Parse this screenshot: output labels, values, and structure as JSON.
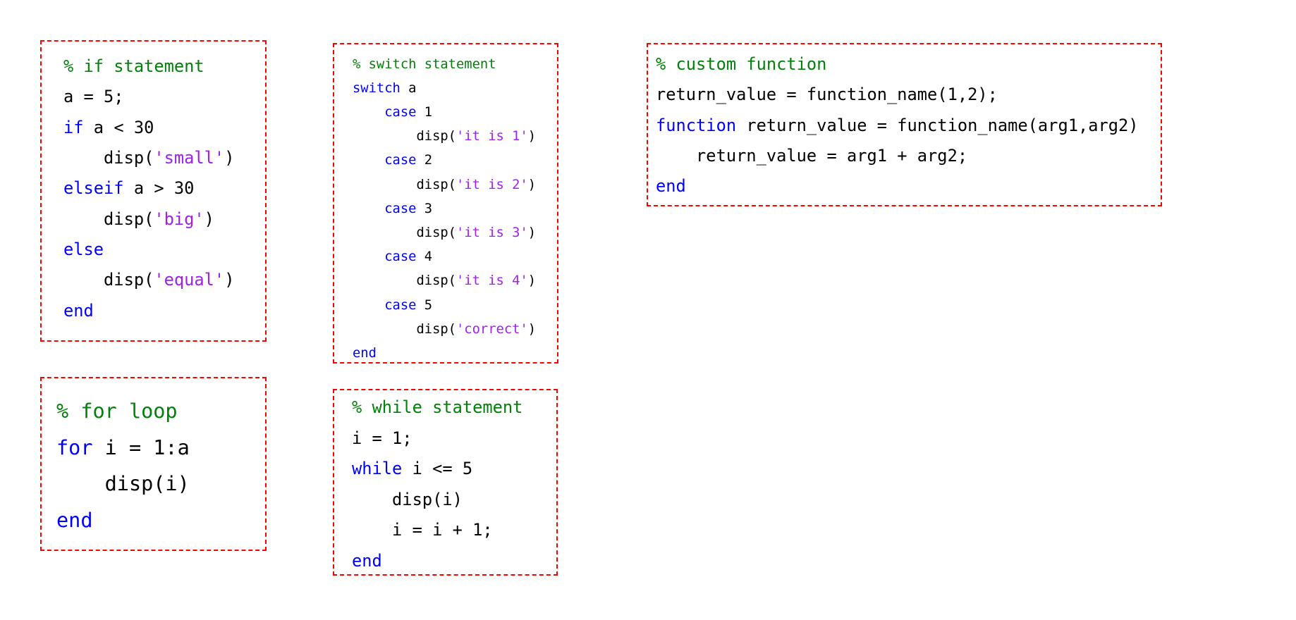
{
  "colors": {
    "comment": "#028009",
    "keyword": "#0000ff",
    "string": "#a020f0",
    "plain": "#000000",
    "border": "#ff0000"
  },
  "blocks": {
    "if_statement": {
      "lines": [
        [
          {
            "t": "comment",
            "v": "% if statement"
          }
        ],
        [
          {
            "t": "plain",
            "v": "a = 5;"
          }
        ],
        [
          {
            "t": "keyword",
            "v": "if"
          },
          {
            "t": "plain",
            "v": " a < 30"
          }
        ],
        [
          {
            "t": "plain",
            "v": "    disp("
          },
          {
            "t": "string",
            "v": "'small'"
          },
          {
            "t": "plain",
            "v": ")"
          }
        ],
        [
          {
            "t": "keyword",
            "v": "elseif"
          },
          {
            "t": "plain",
            "v": " a > 30"
          }
        ],
        [
          {
            "t": "plain",
            "v": "    disp("
          },
          {
            "t": "string",
            "v": "'big'"
          },
          {
            "t": "plain",
            "v": ")"
          }
        ],
        [
          {
            "t": "keyword",
            "v": "else"
          }
        ],
        [
          {
            "t": "plain",
            "v": "    disp("
          },
          {
            "t": "string",
            "v": "'equal'"
          },
          {
            "t": "plain",
            "v": ")"
          }
        ],
        [
          {
            "t": "keyword",
            "v": "end"
          }
        ]
      ]
    },
    "switch_statement": {
      "lines": [
        [
          {
            "t": "comment",
            "v": "% switch statement"
          }
        ],
        [
          {
            "t": "keyword",
            "v": "switch"
          },
          {
            "t": "plain",
            "v": " a"
          }
        ],
        [
          {
            "t": "plain",
            "v": "    "
          },
          {
            "t": "keyword",
            "v": "case"
          },
          {
            "t": "plain",
            "v": " 1"
          }
        ],
        [
          {
            "t": "plain",
            "v": "        disp("
          },
          {
            "t": "string",
            "v": "'it is 1'"
          },
          {
            "t": "plain",
            "v": ")"
          }
        ],
        [
          {
            "t": "plain",
            "v": "    "
          },
          {
            "t": "keyword",
            "v": "case"
          },
          {
            "t": "plain",
            "v": " 2"
          }
        ],
        [
          {
            "t": "plain",
            "v": "        disp("
          },
          {
            "t": "string",
            "v": "'it is 2'"
          },
          {
            "t": "plain",
            "v": ")"
          }
        ],
        [
          {
            "t": "plain",
            "v": "    "
          },
          {
            "t": "keyword",
            "v": "case"
          },
          {
            "t": "plain",
            "v": " 3"
          }
        ],
        [
          {
            "t": "plain",
            "v": "        disp("
          },
          {
            "t": "string",
            "v": "'it is 3'"
          },
          {
            "t": "plain",
            "v": ")"
          }
        ],
        [
          {
            "t": "plain",
            "v": "    "
          },
          {
            "t": "keyword",
            "v": "case"
          },
          {
            "t": "plain",
            "v": " 4"
          }
        ],
        [
          {
            "t": "plain",
            "v": "        disp("
          },
          {
            "t": "string",
            "v": "'it is 4'"
          },
          {
            "t": "plain",
            "v": ")"
          }
        ],
        [
          {
            "t": "plain",
            "v": "    "
          },
          {
            "t": "keyword",
            "v": "case"
          },
          {
            "t": "plain",
            "v": " 5"
          }
        ],
        [
          {
            "t": "plain",
            "v": "        disp("
          },
          {
            "t": "string",
            "v": "'correct'"
          },
          {
            "t": "plain",
            "v": ")"
          }
        ],
        [
          {
            "t": "keyword",
            "v": "end"
          }
        ]
      ]
    },
    "custom_function": {
      "lines": [
        [
          {
            "t": "comment",
            "v": "% custom function"
          }
        ],
        [
          {
            "t": "plain",
            "v": "return_value = function_name(1,2);"
          }
        ],
        [
          {
            "t": "keyword",
            "v": "function"
          },
          {
            "t": "plain",
            "v": " return_value = function_name(arg1,arg2)"
          }
        ],
        [
          {
            "t": "plain",
            "v": "    return_value = arg1 + arg2;"
          }
        ],
        [
          {
            "t": "keyword",
            "v": "end"
          }
        ]
      ]
    },
    "for_loop": {
      "lines": [
        [
          {
            "t": "comment",
            "v": "% for loop"
          }
        ],
        [
          {
            "t": "keyword",
            "v": "for"
          },
          {
            "t": "plain",
            "v": " i = 1:a"
          }
        ],
        [
          {
            "t": "plain",
            "v": "    disp(i)"
          }
        ],
        [
          {
            "t": "keyword",
            "v": "end"
          }
        ]
      ]
    },
    "while_statement": {
      "lines": [
        [
          {
            "t": "comment",
            "v": "% while statement"
          }
        ],
        [
          {
            "t": "plain",
            "v": "i = 1;"
          }
        ],
        [
          {
            "t": "keyword",
            "v": "while"
          },
          {
            "t": "plain",
            "v": " i <= 5"
          }
        ],
        [
          {
            "t": "plain",
            "v": "    disp(i)"
          }
        ],
        [
          {
            "t": "plain",
            "v": "    i = i + 1;"
          }
        ],
        [
          {
            "t": "keyword",
            "v": "end"
          }
        ]
      ]
    }
  }
}
